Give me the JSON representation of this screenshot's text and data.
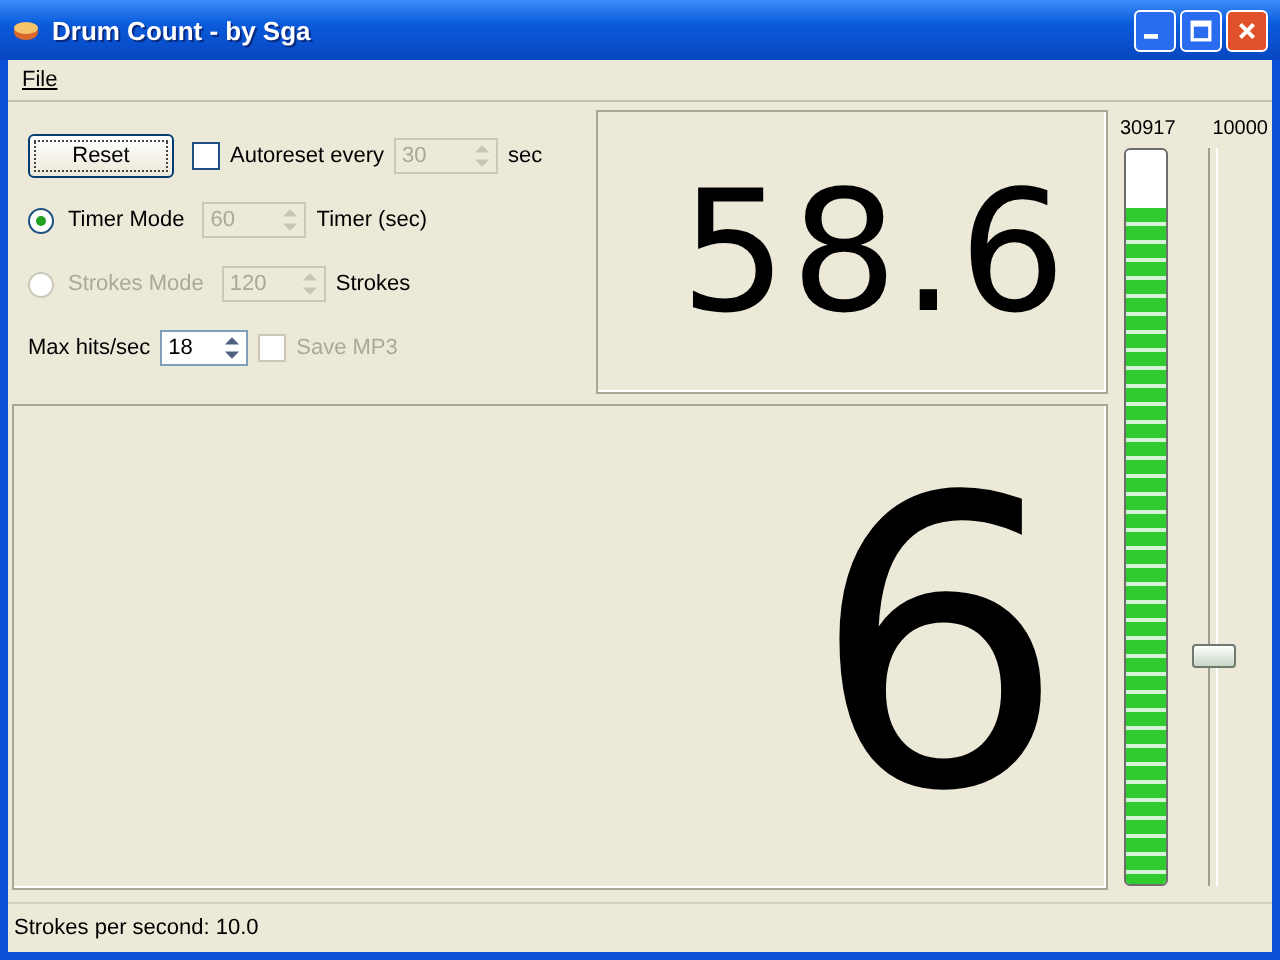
{
  "window": {
    "title": "Drum Count - by Sga"
  },
  "menu": [
    "File"
  ],
  "reset": {
    "label": "Reset"
  },
  "autoreset": {
    "label": "Autoreset every",
    "checked": false,
    "spin": {
      "value": "30",
      "disabled": true
    },
    "unit": "sec"
  },
  "modes": [
    {
      "label": "Timer Mode",
      "selected": true,
      "disabled": false,
      "spin": {
        "value": "60",
        "disabled": true
      },
      "unit": "Timer (sec)"
    },
    {
      "label": "Strokes Mode",
      "selected": false,
      "disabled": true,
      "spin": {
        "value": "120",
        "disabled": true
      },
      "unit": "Strokes"
    }
  ],
  "max_hits": {
    "label": "Max hits/sec",
    "spin": {
      "value": "18",
      "disabled": false
    }
  },
  "save_mp3": {
    "label": "Save MP3",
    "checked": false,
    "disabled": true
  },
  "timer_display": "58.6",
  "count_display": "6",
  "meter": {
    "reading": "30917",
    "level": 0.92
  },
  "slider": {
    "reading": "10000",
    "level": 0.31
  },
  "status_bar": "Strokes per second: 10.0"
}
